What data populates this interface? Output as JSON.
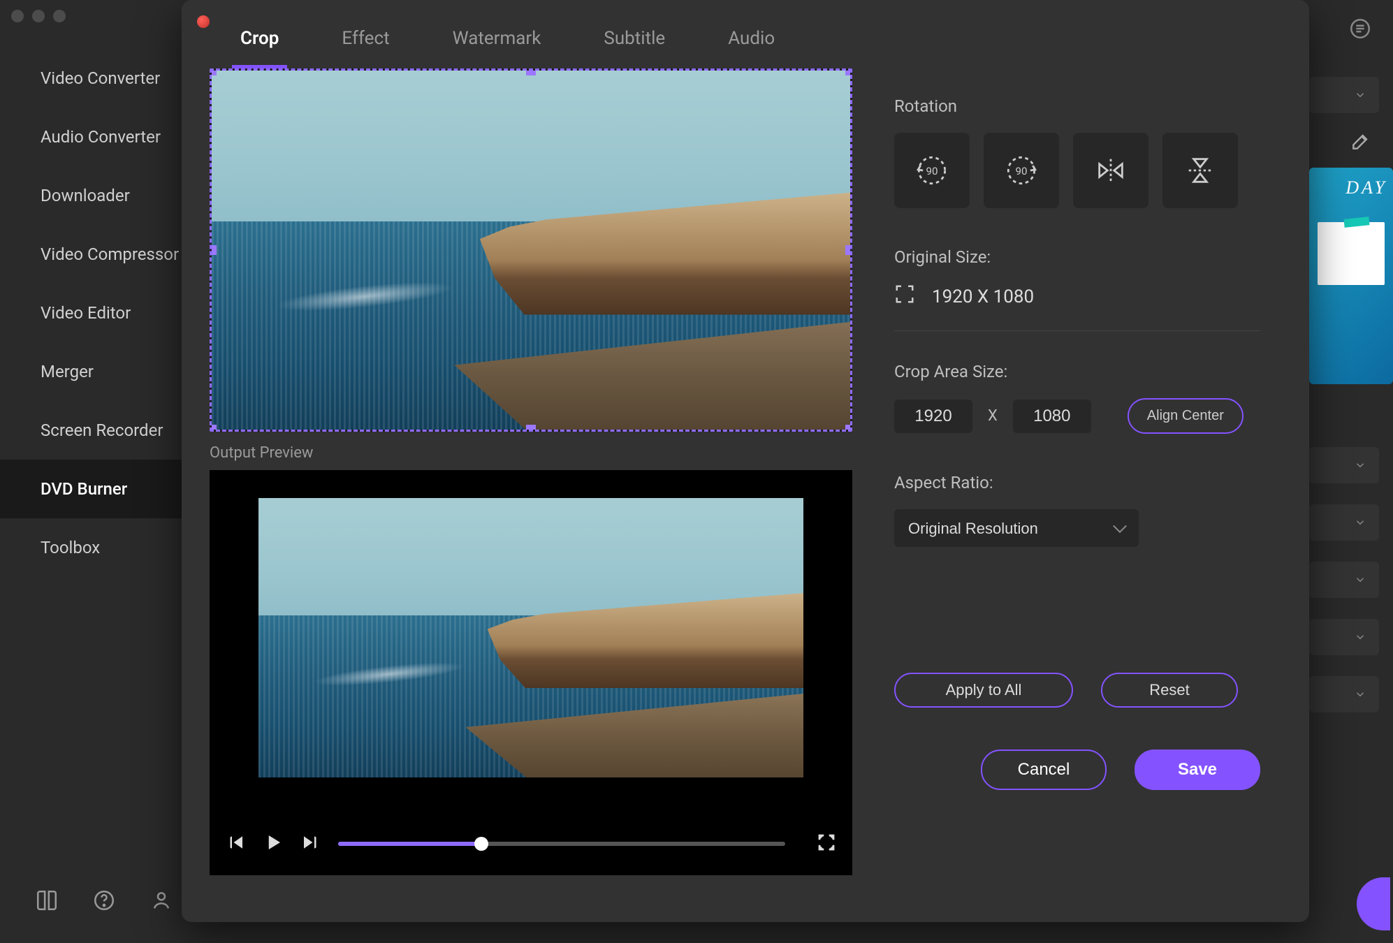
{
  "sidebar": {
    "items": [
      {
        "label": "Video Converter"
      },
      {
        "label": "Audio Converter"
      },
      {
        "label": "Downloader"
      },
      {
        "label": "Video Compressor"
      },
      {
        "label": "Video Editor"
      },
      {
        "label": "Merger"
      },
      {
        "label": "Screen Recorder"
      },
      {
        "label": "DVD Burner"
      },
      {
        "label": "Toolbox"
      }
    ],
    "active_index": 7
  },
  "bg_promo_text": "DAY",
  "modal": {
    "tabs": [
      "Crop",
      "Effect",
      "Watermark",
      "Subtitle",
      "Audio"
    ],
    "active_tab": 0,
    "output_preview_label": "Output Preview",
    "player_progress_pct": 32,
    "rotation_label": "Rotation",
    "original_size_label": "Original Size:",
    "original_size_value": "1920 X 1080",
    "crop_area_label": "Crop Area Size:",
    "crop_width": "1920",
    "crop_height": "1080",
    "crop_sep": "X",
    "align_center_label": "Align Center",
    "aspect_ratio_label": "Aspect Ratio:",
    "aspect_ratio_value": "Original Resolution",
    "apply_all_label": "Apply to All",
    "reset_label": "Reset",
    "cancel_label": "Cancel",
    "save_label": "Save"
  }
}
